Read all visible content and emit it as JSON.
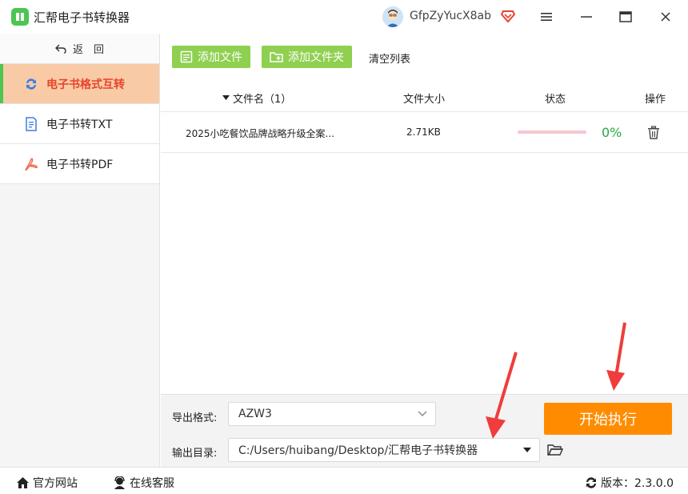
{
  "app": {
    "title": "汇帮电子书转换器",
    "username": "GfpZyYucX8ab",
    "accent_green": "#4cc552",
    "accent_orange": "#ff8c00"
  },
  "window_controls": {
    "menu_icon": "hamburger-icon",
    "maximize_icon": "maximize-icon",
    "close_icon": "close-icon"
  },
  "sidebar": {
    "back_label": "返　回",
    "items": [
      {
        "label": "电子书格式互转",
        "icon": "refresh-icon",
        "active": true
      },
      {
        "label": "电子书转TXT",
        "icon": "document-icon",
        "active": false
      },
      {
        "label": "电子书转PDF",
        "icon": "pdf-icon",
        "active": false
      }
    ]
  },
  "toolbar": {
    "add_file": "添加文件",
    "add_folder": "添加文件夹",
    "clear_list": "清空列表"
  },
  "table": {
    "headers": {
      "filename": "文件名（1）",
      "size": "文件大小",
      "status": "状态",
      "action": "操作"
    },
    "rows": [
      {
        "filename": "2025小吃餐饮品牌战略升级全案...",
        "size": "2.71KB",
        "progress": 0,
        "percent_text": "0%"
      }
    ]
  },
  "settings": {
    "format_label": "导出格式:",
    "format_value": "AZW3",
    "output_label": "输出目录:",
    "output_value": "C:/Users/huibang/Desktop/汇帮电子书转换器",
    "start_button": "开始执行"
  },
  "statusbar": {
    "website": "官方网站",
    "support": "在线客服",
    "version": "版本：2.3.0.0"
  }
}
